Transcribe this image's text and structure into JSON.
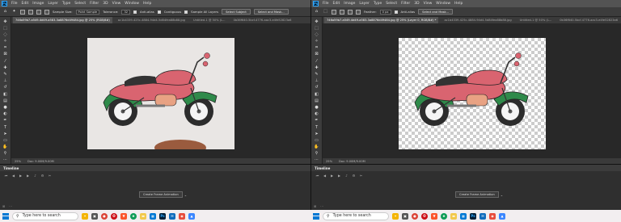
{
  "menu": [
    "File",
    "Edit",
    "Image",
    "Layer",
    "Type",
    "Select",
    "Filter",
    "3D",
    "View",
    "Window",
    "Help"
  ],
  "app_logo": "Ps",
  "left": {
    "options": {
      "sample_size_label": "Sample Size:",
      "sample_size_value": "Point Sample",
      "tolerance_label": "Tolerance:",
      "tolerance_value": "32",
      "anti_alias_label": "Anti-alias",
      "contiguous_label": "Contiguous",
      "sample_all_layers_label": "Sample All Layers",
      "select_subject_label": "Select Subject",
      "select_mask_label": "Select and Mask..."
    },
    "tabs": [
      "746a59b7-a549-4d49-a583-3a8876d49484.jpg @ 25% (RGB/8#)",
      "ac1b4339-425c-4884-94d4-5d84fea88b88.jpg",
      "Untitled-1 @ 50% (L...",
      "0b36f640-5bcf-4776-aac3-e4fe52823a6"
    ],
    "status_zoom": "25%",
    "status_doc": "Doc: 9.00M/9.00M",
    "timeline_title": "Timeline",
    "frame_button_label": "Create Frame Animation"
  },
  "right": {
    "options": {
      "feather_label": "Feather:",
      "feather_value": "0 px",
      "anti_alias_label": "Anti-alias",
      "select_mask_label": "Select and Mask..."
    },
    "tabs": [
      "746a59b7-a549-4d49-a583-3a8876d49484.jpg @ 25% (Layer 0, RGB/8#) *",
      "ac1b4339-425c-4884-94d4-5d84fea88b88.jpg",
      "Untitled-1 @ 50% (L...",
      "0b36f640-5bcf-4776-aac3-e4fe52823a6"
    ],
    "status_zoom": "25%",
    "status_doc": "Doc: 9.00M/9.00M",
    "timeline_title": "Timeline",
    "frame_button_label": "Create Frame Animation"
  },
  "taskbar": {
    "search_placeholder": "Type here to search",
    "icons": [
      "search-highlight-icon",
      "task-view-icon",
      "chrome-icon",
      "opera-icon",
      "brave-icon",
      "edge-icon",
      "file-explorer-icon",
      "store-icon",
      "photoshop-icon",
      "mail-icon",
      "maps-icon",
      "photos-icon"
    ]
  },
  "colors": {
    "bike_red": "#d96470",
    "bike_green": "#2f8a4a",
    "bike_seat": "#333333",
    "bike_engine": "#e8a283",
    "bike_tire": "#2c2c2c",
    "ps_blue": "#31a8ff"
  }
}
